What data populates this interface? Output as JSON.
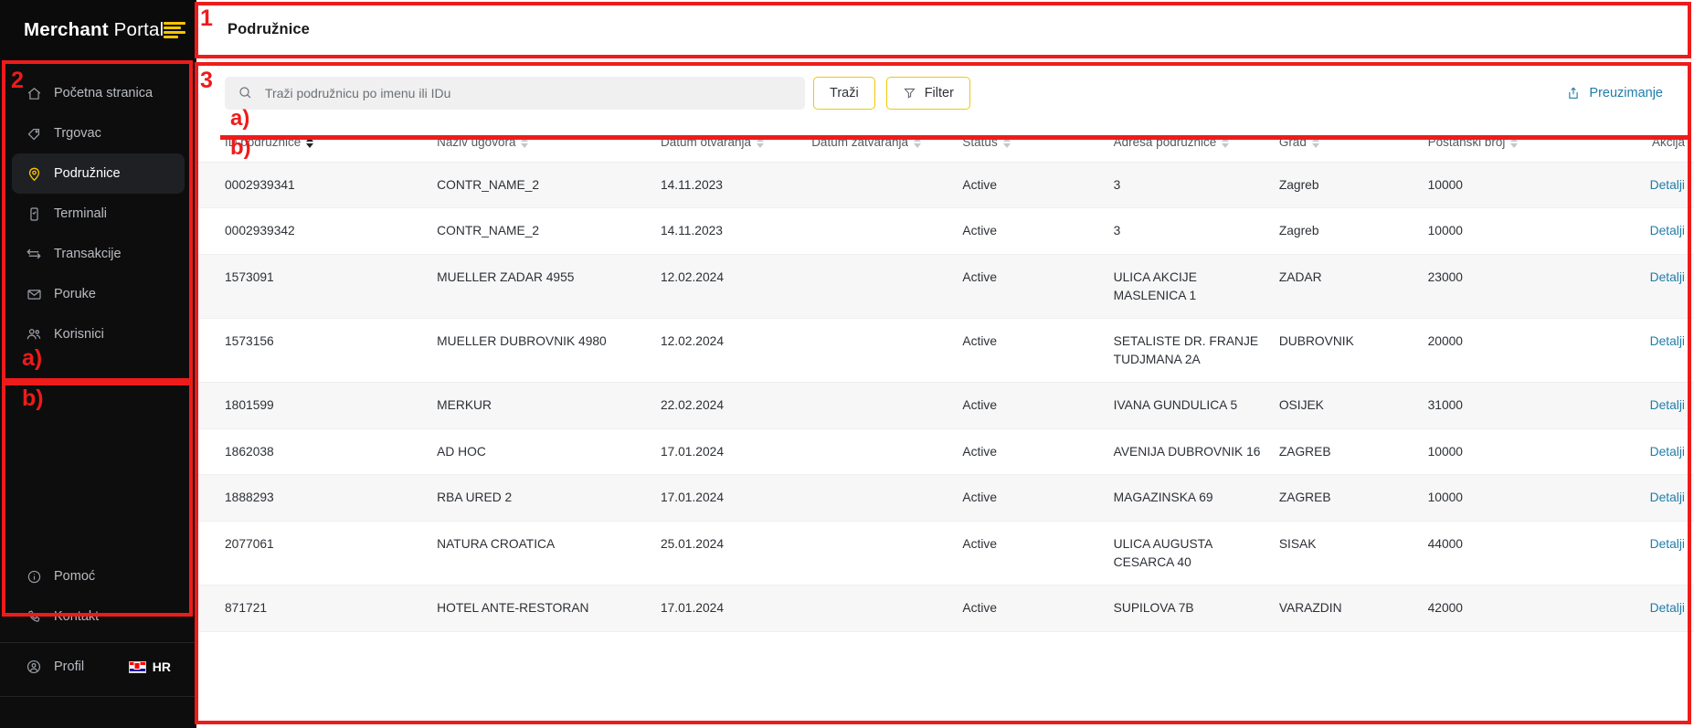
{
  "brand": {
    "bold": "Merchant",
    "light": " Portal",
    "menu_icon": "hamburger-icon"
  },
  "sidebar": {
    "primary_items": [
      {
        "label": "Početna stranica",
        "icon": "home-icon",
        "active": false
      },
      {
        "label": "Trgovac",
        "icon": "tag-icon",
        "active": false
      },
      {
        "label": "Podružnice",
        "icon": "location-pin-icon",
        "active": true
      },
      {
        "label": "Terminali",
        "icon": "terminal-device-icon",
        "active": false
      },
      {
        "label": "Transakcije",
        "icon": "transfer-arrows-icon",
        "active": false
      },
      {
        "label": "Poruke",
        "icon": "envelope-icon",
        "active": false
      },
      {
        "label": "Korisnici",
        "icon": "users-icon",
        "active": false
      }
    ],
    "secondary_items": [
      {
        "label": "Pomoć",
        "icon": "info-circle-icon"
      },
      {
        "label": "Kontakt",
        "icon": "phone-icon"
      }
    ],
    "profile": {
      "label": "Profil",
      "icon": "person-circle-icon"
    },
    "language": {
      "code": "HR",
      "flag": "croatia-flag-icon"
    }
  },
  "header": {
    "title": "Podružnice"
  },
  "toolbar": {
    "search_placeholder": "Traži podružnicu po imenu ili IDu",
    "search_value": "",
    "search_icon": "search-icon",
    "search_button": "Traži",
    "filter_button": "Filter",
    "filter_icon": "filter-funnel-icon",
    "download_label": "Preuzimanje",
    "download_icon": "upload-share-icon"
  },
  "table": {
    "columns": [
      {
        "label": "ID podružnice",
        "sortable": true,
        "sort_active": true
      },
      {
        "label": "Naziv ugovora",
        "sortable": true,
        "sort_active": false
      },
      {
        "label": "Datum otvaranja",
        "sortable": true,
        "sort_active": false
      },
      {
        "label": "Datum zatvaranja",
        "sortable": true,
        "sort_active": false
      },
      {
        "label": "Status",
        "sortable": true,
        "sort_active": false
      },
      {
        "label": "Adresa podružnice",
        "sortable": true,
        "sort_active": false
      },
      {
        "label": "Grad",
        "sortable": true,
        "sort_active": false
      },
      {
        "label": "Poštanski broj",
        "sortable": true,
        "sort_active": false
      },
      {
        "label": "Akcija",
        "sortable": false,
        "sort_active": false
      }
    ],
    "action_label": "Detalji",
    "rows": [
      {
        "id": "0002939341",
        "contract": "CONTR_NAME_2",
        "open_date": "14.11.2023",
        "close_date": "",
        "status": "Active",
        "address": "3",
        "city": "Zagreb",
        "zip": "10000",
        "action": "Detalji"
      },
      {
        "id": "0002939342",
        "contract": "CONTR_NAME_2",
        "open_date": "14.11.2023",
        "close_date": "",
        "status": "Active",
        "address": "3",
        "city": "Zagreb",
        "zip": "10000",
        "action": "Detalji"
      },
      {
        "id": "1573091",
        "contract": "MUELLER ZADAR 4955",
        "open_date": "12.02.2024",
        "close_date": "",
        "status": "Active",
        "address": "ULICA AKCIJE MASLENICA 1",
        "city": "ZADAR",
        "zip": "23000",
        "action": "Detalji"
      },
      {
        "id": "1573156",
        "contract": "MUELLER DUBROVNIK 4980",
        "open_date": "12.02.2024",
        "close_date": "",
        "status": "Active",
        "address": "SETALISTE DR. FRANJE TUDJMANA 2A",
        "city": "DUBROVNIK",
        "zip": "20000",
        "action": "Detalji"
      },
      {
        "id": "1801599",
        "contract": "MERKUR",
        "open_date": "22.02.2024",
        "close_date": "",
        "status": "Active",
        "address": "IVANA GUNDULICA 5",
        "city": "OSIJEK",
        "zip": "31000",
        "action": "Detalji"
      },
      {
        "id": "1862038",
        "contract": "AD HOC",
        "open_date": "17.01.2024",
        "close_date": "",
        "status": "Active",
        "address": "AVENIJA DUBROVNIK 16",
        "city": "ZAGREB",
        "zip": "10000",
        "action": "Detalji"
      },
      {
        "id": "1888293",
        "contract": "RBA URED 2",
        "open_date": "17.01.2024",
        "close_date": "",
        "status": "Active",
        "address": "MAGAZINSKA 69",
        "city": "ZAGREB",
        "zip": "10000",
        "action": "Detalji"
      },
      {
        "id": "2077061",
        "contract": "NATURA CROATICA",
        "open_date": "25.01.2024",
        "close_date": "",
        "status": "Active",
        "address": "ULICA AUGUSTA CESARCA 40",
        "city": "SISAK",
        "zip": "44000",
        "action": "Detalji"
      },
      {
        "id": "871721",
        "contract": "HOTEL ANTE-RESTORAN",
        "open_date": "17.01.2024",
        "close_date": "",
        "status": "Active",
        "address": "SUPILOVA 7B",
        "city": "VARAZDIN",
        "zip": "42000",
        "action": "Detalji"
      }
    ]
  },
  "annotations": {
    "color": "#ee1b1b",
    "marks": [
      {
        "text": "1"
      },
      {
        "text": "2"
      },
      {
        "text": "3"
      },
      {
        "text": "a)"
      },
      {
        "text": "b)"
      },
      {
        "text": "a)"
      },
      {
        "text": "b)"
      }
    ]
  }
}
